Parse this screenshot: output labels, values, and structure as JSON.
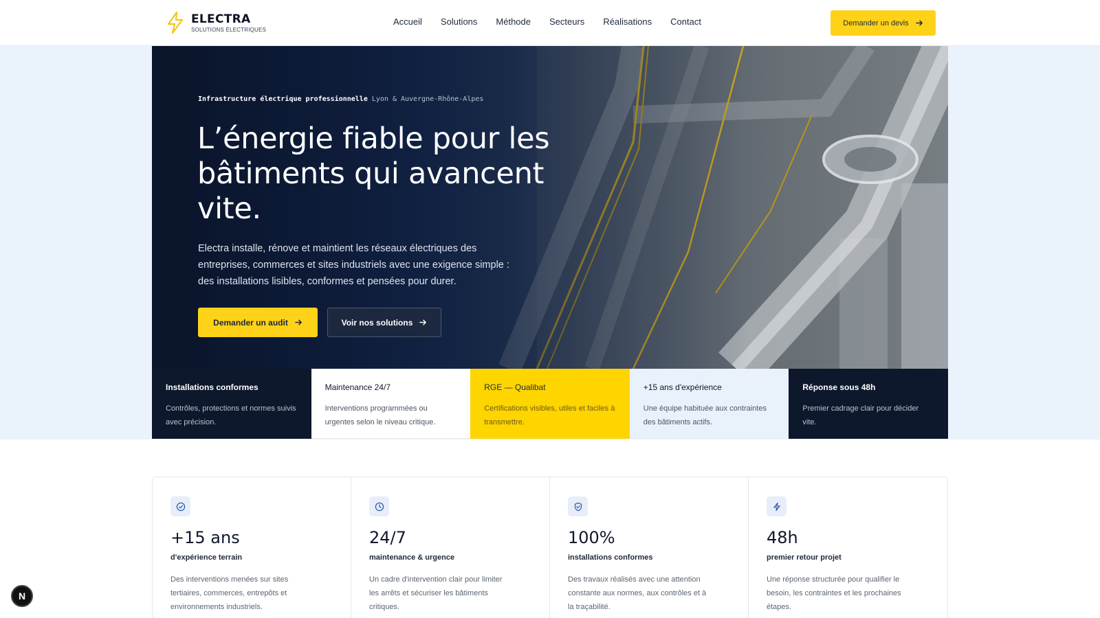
{
  "brand": {
    "name": "ELECTRA",
    "tagline": "SOLUTIONS ÉLECTRIQUES",
    "accent_color": "#ffd21a",
    "dark_color": "#0d182c"
  },
  "nav": {
    "items": [
      {
        "label": "Accueil"
      },
      {
        "label": "Solutions"
      },
      {
        "label": "Méthode"
      },
      {
        "label": "Secteurs"
      },
      {
        "label": "Réalisations"
      },
      {
        "label": "Contact"
      }
    ],
    "cta_label": "Demander un devis"
  },
  "hero": {
    "eyebrow_strong": "Infrastructure électrique professionnelle",
    "eyebrow_light": "Lyon & Auvergne-Rhône-Alpes",
    "title": "L’énergie fiable pour les bâtiments qui avancent vite.",
    "subtitle": "Electra installe, rénove et maintient les réseaux électriques des entreprises, commerces et sites industriels avec une exigence simple : des installations lisibles, conformes et pensées pour durer.",
    "primary_cta": "Demander un audit",
    "secondary_cta": "Voir nos solutions"
  },
  "strip": [
    {
      "title": "Installations conformes",
      "desc": "Contrôles, protections et normes suivis avec précision."
    },
    {
      "title": "Maintenance 24/7",
      "desc": "Interventions programmées ou urgentes selon le niveau critique."
    },
    {
      "title": "RGE — Qualibat",
      "desc": "Certifications visibles, utiles et faciles à transmettre."
    },
    {
      "title": "+15 ans d'expérience",
      "desc": "Une équipe habituée aux contraintes des bâtiments actifs."
    },
    {
      "title": "Réponse sous 48h",
      "desc": "Premier cadrage clair pour décider vite."
    }
  ],
  "stats": [
    {
      "icon": "check-circle-icon",
      "value": "+15 ans",
      "label": "d'expérience terrain",
      "desc": "Des interventions menées sur sites tertiaires, commerces, entrepôts et environnements industriels."
    },
    {
      "icon": "clock-icon",
      "value": "24/7",
      "label": "maintenance & urgence",
      "desc": "Un cadre d'intervention clair pour limiter les arrêts et sécuriser les bâtiments critiques."
    },
    {
      "icon": "shield-check-icon",
      "value": "100%",
      "label": "installations conformes",
      "desc": "Des travaux réalisés avec une attention constante aux normes, aux contrôles et à la traçabilité."
    },
    {
      "icon": "lightning-icon",
      "value": "48h",
      "label": "premier retour projet",
      "desc": "Une réponse structurée pour qualifier le besoin, les contraintes et les prochaines étapes."
    }
  ],
  "dev_badge": "N"
}
